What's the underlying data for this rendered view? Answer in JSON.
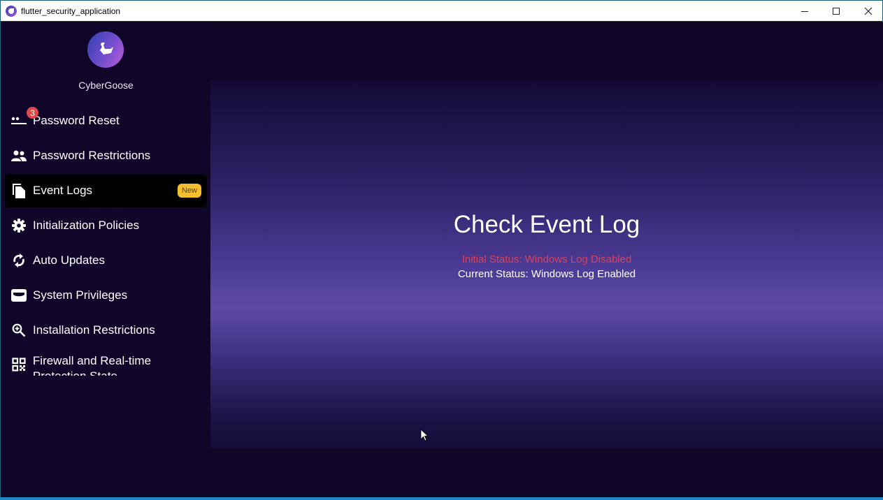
{
  "window": {
    "title": "flutter_security_application",
    "controls": {
      "minimize": "minimize",
      "maximize": "maximize",
      "close": "close"
    }
  },
  "sidebar": {
    "brand_name": "CyberGoose",
    "items": [
      {
        "label": "Password Reset",
        "icon": "password-icon",
        "badge_count": "3",
        "active": false
      },
      {
        "label": "Password Restrictions",
        "icon": "people-icon",
        "active": false
      },
      {
        "label": "Event Logs",
        "icon": "file-copy-icon",
        "badge_text": "New",
        "active": true
      },
      {
        "label": "Initialization Policies",
        "icon": "gear-icon",
        "active": false
      },
      {
        "label": "Auto Updates",
        "icon": "refresh-icon",
        "active": false
      },
      {
        "label": "System Privileges",
        "icon": "inbox-icon",
        "active": false
      },
      {
        "label": "Installation Restrictions",
        "icon": "zoom-in-icon",
        "active": false
      },
      {
        "label": "Firewall and Real-time Protection State",
        "icon": "qr-code-icon",
        "active": false
      }
    ]
  },
  "main": {
    "title": "Check Event Log",
    "initial_status": "Initial Status: Windows Log Disabled",
    "current_status": "Current Status: Windows Log Enabled"
  },
  "colors": {
    "sidebar_bg": "#10062a",
    "active_item_bg": "#000000",
    "badge_red": "#e04848",
    "badge_new": "#f5be2e",
    "initial_status_color": "#d8435a",
    "accent_purple": "#5e4ba8"
  }
}
